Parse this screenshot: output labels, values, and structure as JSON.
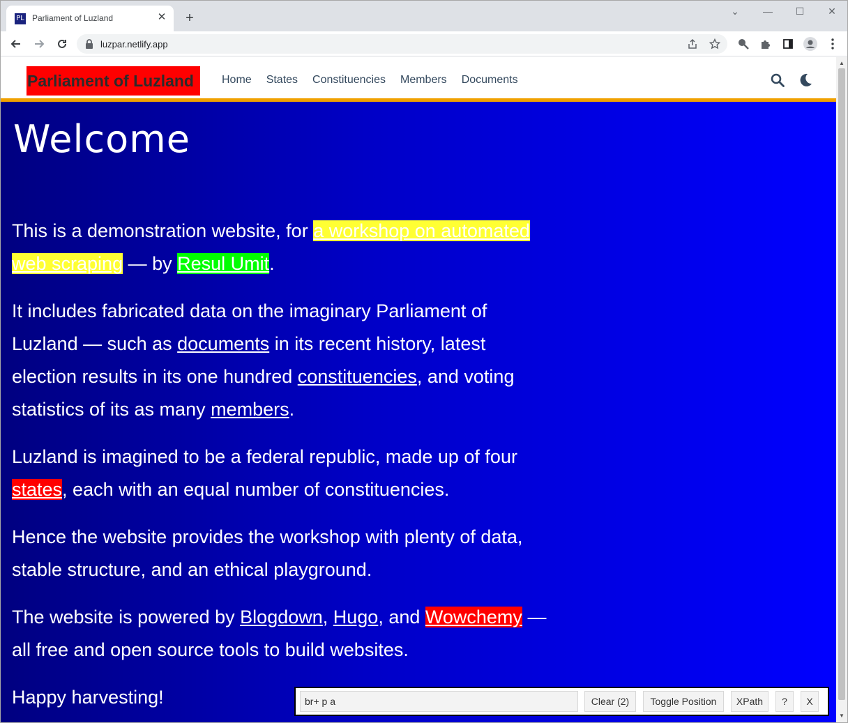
{
  "browser": {
    "tab_title": "Parliament of Luzland",
    "favicon_text": "PL",
    "tab_close": "✕",
    "new_tab": "+",
    "url": "luzpar.netlify.app",
    "window_controls": {
      "collapse": "⌄",
      "minimize": "—",
      "maximize": "☐",
      "close": "✕"
    }
  },
  "site_nav": {
    "brand": "Parliament of Luzland",
    "links": [
      "Home",
      "States",
      "Constituencies",
      "Members",
      "Documents"
    ]
  },
  "content": {
    "heading": "Welcome",
    "p1": {
      "t1": "This is a demonstration website, for ",
      "link_workshop": "a workshop on automated web scraping",
      "t2": " — by ",
      "link_author": "Resul Umit",
      "t3": "."
    },
    "p2": {
      "t1": "It includes fabricated data on the imaginary Parliament of Luzland — such as ",
      "link_documents": "documents",
      "t2": " in its recent history, latest election results in its one hundred ",
      "link_constituencies": "constituencies",
      "t3": ", and voting statistics of its as many ",
      "link_members": "members",
      "t4": "."
    },
    "p3": {
      "t1": "Luzland is imagined to be a federal republic, made up of four ",
      "link_states": "states",
      "t2": ", each with an equal number of constituencies."
    },
    "p4": {
      "t1": "Hence the website provides the workshop with plenty of data, stable structure, and an ethical playground."
    },
    "p5": {
      "t1": "The website is powered by ",
      "link_blogdown": "Blogdown",
      "t2": ", ",
      "link_hugo": "Hugo",
      "t3": ", and ",
      "link_wowchemy": "Wowchemy",
      "t4": " — all free and open source tools to build websites."
    },
    "p6": {
      "t1": "Happy harvesting!"
    }
  },
  "selector_gadget": {
    "selector": "br+ p a",
    "clear_label": "Clear (2)",
    "toggle_label": "Toggle Position",
    "xpath_label": "XPath",
    "help_label": "?",
    "close_label": "X"
  },
  "colors": {
    "highlight_yellow": "#ffff33",
    "highlight_green": "#00ff00",
    "highlight_red": "#ff0000",
    "nav_border": "#f0a100",
    "page_bg_left": "#000080",
    "page_bg_right": "#0000ff"
  }
}
